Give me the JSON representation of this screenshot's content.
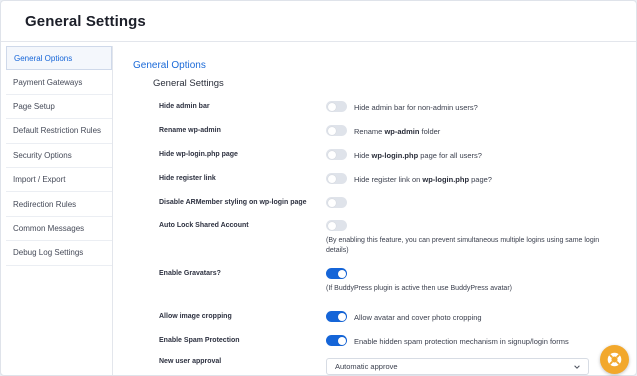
{
  "header": {
    "title": "General Settings"
  },
  "sidebar": {
    "items": [
      {
        "label": "General Options",
        "active": true
      },
      {
        "label": "Payment Gateways"
      },
      {
        "label": "Page Setup"
      },
      {
        "label": "Default Restriction Rules"
      },
      {
        "label": "Security Options"
      },
      {
        "label": "Import / Export"
      },
      {
        "label": "Redirection Rules"
      },
      {
        "label": "Common Messages"
      },
      {
        "label": "Debug Log Settings"
      }
    ]
  },
  "main": {
    "section_title": "General Options",
    "section_subtitle": "General Settings",
    "settings": [
      {
        "label": "Hide admin bar",
        "enabled": false,
        "desc": "Hide admin bar for non-admin users?"
      },
      {
        "label": "Rename wp-admin",
        "enabled": false,
        "desc_pre": "Rename ",
        "desc_bold": "wp-admin",
        "desc_post": " folder"
      },
      {
        "label": "Hide wp-login.php page",
        "enabled": false,
        "desc_pre": "Hide ",
        "desc_bold": "wp-login.php",
        "desc_post": " page for all users?"
      },
      {
        "label": "Hide register link",
        "enabled": false,
        "desc_pre": "Hide register link on ",
        "desc_bold": "wp-login.php",
        "desc_post": " page?"
      },
      {
        "label": "Disable ARMember styling on wp-login page",
        "enabled": false
      },
      {
        "label": "Auto Lock Shared Account",
        "enabled": false,
        "note": "(By enabling this feature, you can prevent simultaneous multiple logins using same login details)"
      },
      {
        "label": "Enable Gravatars?",
        "enabled": true,
        "note": "(If BuddyPress plugin is active then use BuddyPress avatar)"
      },
      {
        "label": "Allow image cropping",
        "enabled": true,
        "desc": "Allow avatar and cover photo cropping"
      },
      {
        "label": "Enable Spam Protection",
        "enabled": true,
        "desc": "Enable hidden spam protection mechanism in signup/login forms"
      },
      {
        "label": "New user approval",
        "select_value": "Automatic approve"
      }
    ]
  },
  "colors": {
    "accent": "#1565d8",
    "toggle_off": "#dfe3ea",
    "fab": "#f2a82c"
  },
  "fab": {
    "icon": "lifebuoy-icon"
  }
}
